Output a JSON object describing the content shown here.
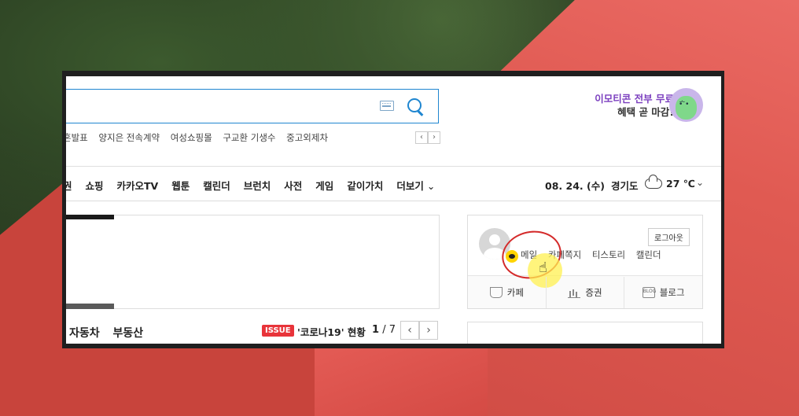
{
  "search": {
    "keyboard_icon": "keyboard-icon",
    "search_icon": "search-icon"
  },
  "trends": [
    "혼발표",
    "양지은 전속계약",
    "여성쇼핑몰",
    "구교환 기생수",
    "중고외제차"
  ],
  "trend_nav": {
    "prev": "‹",
    "next": "›"
  },
  "promo": {
    "line1": "이모티콘 전부 무료",
    "line2": "혜택 곧 마감!"
  },
  "nav": [
    "권",
    "쇼핑",
    "카카오TV",
    "웹툰",
    "캘린더",
    "브런치",
    "사전",
    "게임",
    "같이가치",
    "더보기"
  ],
  "weather": {
    "date": "08. 24. (수)",
    "region": "경기도",
    "temp": "27 ℃",
    "chevron": "⌄"
  },
  "categories": [
    "자동차",
    "부동산"
  ],
  "issue": {
    "badge": "ISSUE",
    "text": "'코로나19' 현황",
    "page_current": "1",
    "page_total": "/ 7",
    "prev": "‹",
    "next": "›"
  },
  "login": {
    "logout": "로그아웃",
    "services": [
      "메일",
      "카페쪽지",
      "티스토리",
      "캘린더"
    ],
    "bottom": [
      {
        "label": "카페",
        "icon": "cup-icon",
        "glyph": ""
      },
      {
        "label": "증권",
        "icon": "chart-icon",
        "glyph": ""
      },
      {
        "label": "블로그",
        "icon": "blog-icon",
        "glyph": "BLOG"
      }
    ]
  },
  "colors": {
    "accent_blue": "#1f86d0",
    "issue_red": "#e8343a",
    "promo_purple": "#7b3fbf"
  }
}
